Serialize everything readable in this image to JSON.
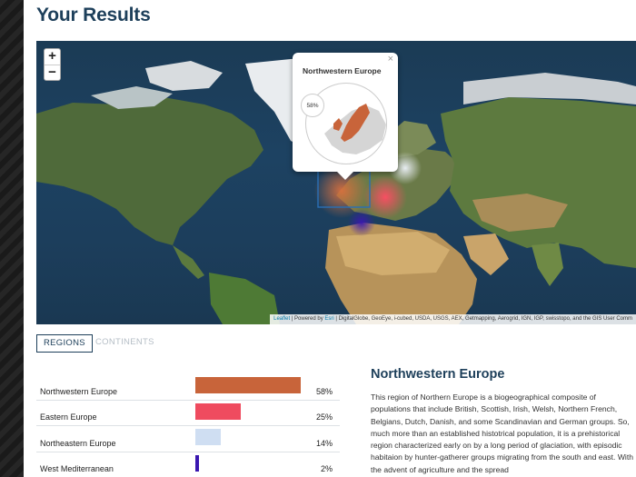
{
  "page": {
    "title": "Your Results"
  },
  "map": {
    "zoom_in": "+",
    "zoom_out": "−",
    "popup": {
      "title": "Northwestern Europe",
      "percent": "58%",
      "close": "×"
    },
    "attribution": {
      "leaflet": "Leaflet",
      "powered_by": " | Powered by ",
      "esri": "Esri",
      "rest": " | DigitalGlobe, GeoEye, i-cubed, USDA, USGS, AEX, Getmapping, Aerogrid, IGN, IGP, swisstopo, and the GIS User Comm"
    }
  },
  "tabs": [
    {
      "label": "REGIONS",
      "active": true
    },
    {
      "label": "CONTINENTS",
      "active": false
    }
  ],
  "regions": [
    {
      "name": "Northwestern Europe",
      "percent": "58%",
      "value": 58,
      "color": "#c8643a"
    },
    {
      "name": "Eastern Europe",
      "percent": "25%",
      "value": 25,
      "color": "#ef4b5f"
    },
    {
      "name": "Northeastern Europe",
      "percent": "14%",
      "value": 14,
      "color": "#cfdef2"
    },
    {
      "name": "West Mediterranean",
      "percent": "2%",
      "value": 2,
      "color": "#3a17b0"
    }
  ],
  "detail": {
    "title": "Northwestern Europe",
    "text": "This region of Northern Europe is a biogeographical composite of populations that include British, Scottish, Irish, Welsh, Northern French, Belgians, Dutch, Danish, and some Scandinavian and German groups. So, much more than an established histotrical population, it is a prehistorical region characterized early on by a long period of glaciation, with episodic habitaion by hunter-gatherer groups migrating from the south and east. With the advent of agriculture and the spread"
  }
}
